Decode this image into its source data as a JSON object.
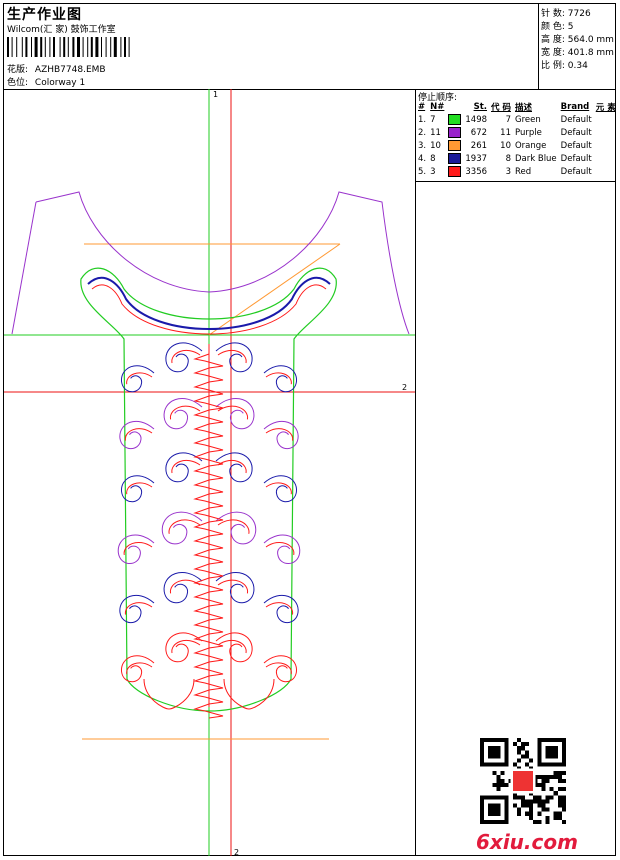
{
  "header": {
    "title": "生产作业图",
    "company": "Wilcom(汇 家) 鼓饰工作室",
    "design_label": "花版:",
    "design_value": "AZHB7748.EMB",
    "color_label": "色位:",
    "color_value": "Colorway 1"
  },
  "stats": [
    {
      "label": "针 数:",
      "value": "7726"
    },
    {
      "label": "颜 色:",
      "value": "5"
    },
    {
      "label": "高 度:",
      "value": "564.0 mm"
    },
    {
      "label": "宽 度:",
      "value": "401.8 mm"
    },
    {
      "label": "比 例:",
      "value": "0.34"
    }
  ],
  "stop_sequence": {
    "title": "停止顺序:",
    "headers": [
      "#",
      "N#",
      "St.",
      "代 码",
      "描述",
      "Brand",
      "元 素"
    ],
    "rows": [
      {
        "idx": "1.",
        "n": "7",
        "color": "#22dd22",
        "st": "1498",
        "code": "7",
        "desc": "Green",
        "brand": "Default"
      },
      {
        "idx": "2.",
        "n": "11",
        "color": "#9922cc",
        "st": "672",
        "code": "11",
        "desc": "Purple",
        "brand": "Default"
      },
      {
        "idx": "3.",
        "n": "10",
        "color": "#ff9933",
        "st": "261",
        "code": "10",
        "desc": "Orange",
        "brand": "Default"
      },
      {
        "idx": "4.",
        "n": "8",
        "color": "#1a1a99",
        "st": "1937",
        "code": "8",
        "desc": "Dark Blue",
        "brand": "Default"
      },
      {
        "idx": "5.",
        "n": "3",
        "color": "#ff1a1a",
        "st": "3356",
        "code": "3",
        "desc": "Red",
        "brand": "Default"
      }
    ]
  },
  "axes": {
    "v_green": "1",
    "h_red": "2",
    "v_red": "2"
  },
  "watermark": "6xiu.com",
  "colors": {
    "green": "#22cc22",
    "purple": "#9933cc",
    "orange": "#ff9933",
    "blue": "#1a1aaa",
    "red": "#ff1a1a"
  }
}
